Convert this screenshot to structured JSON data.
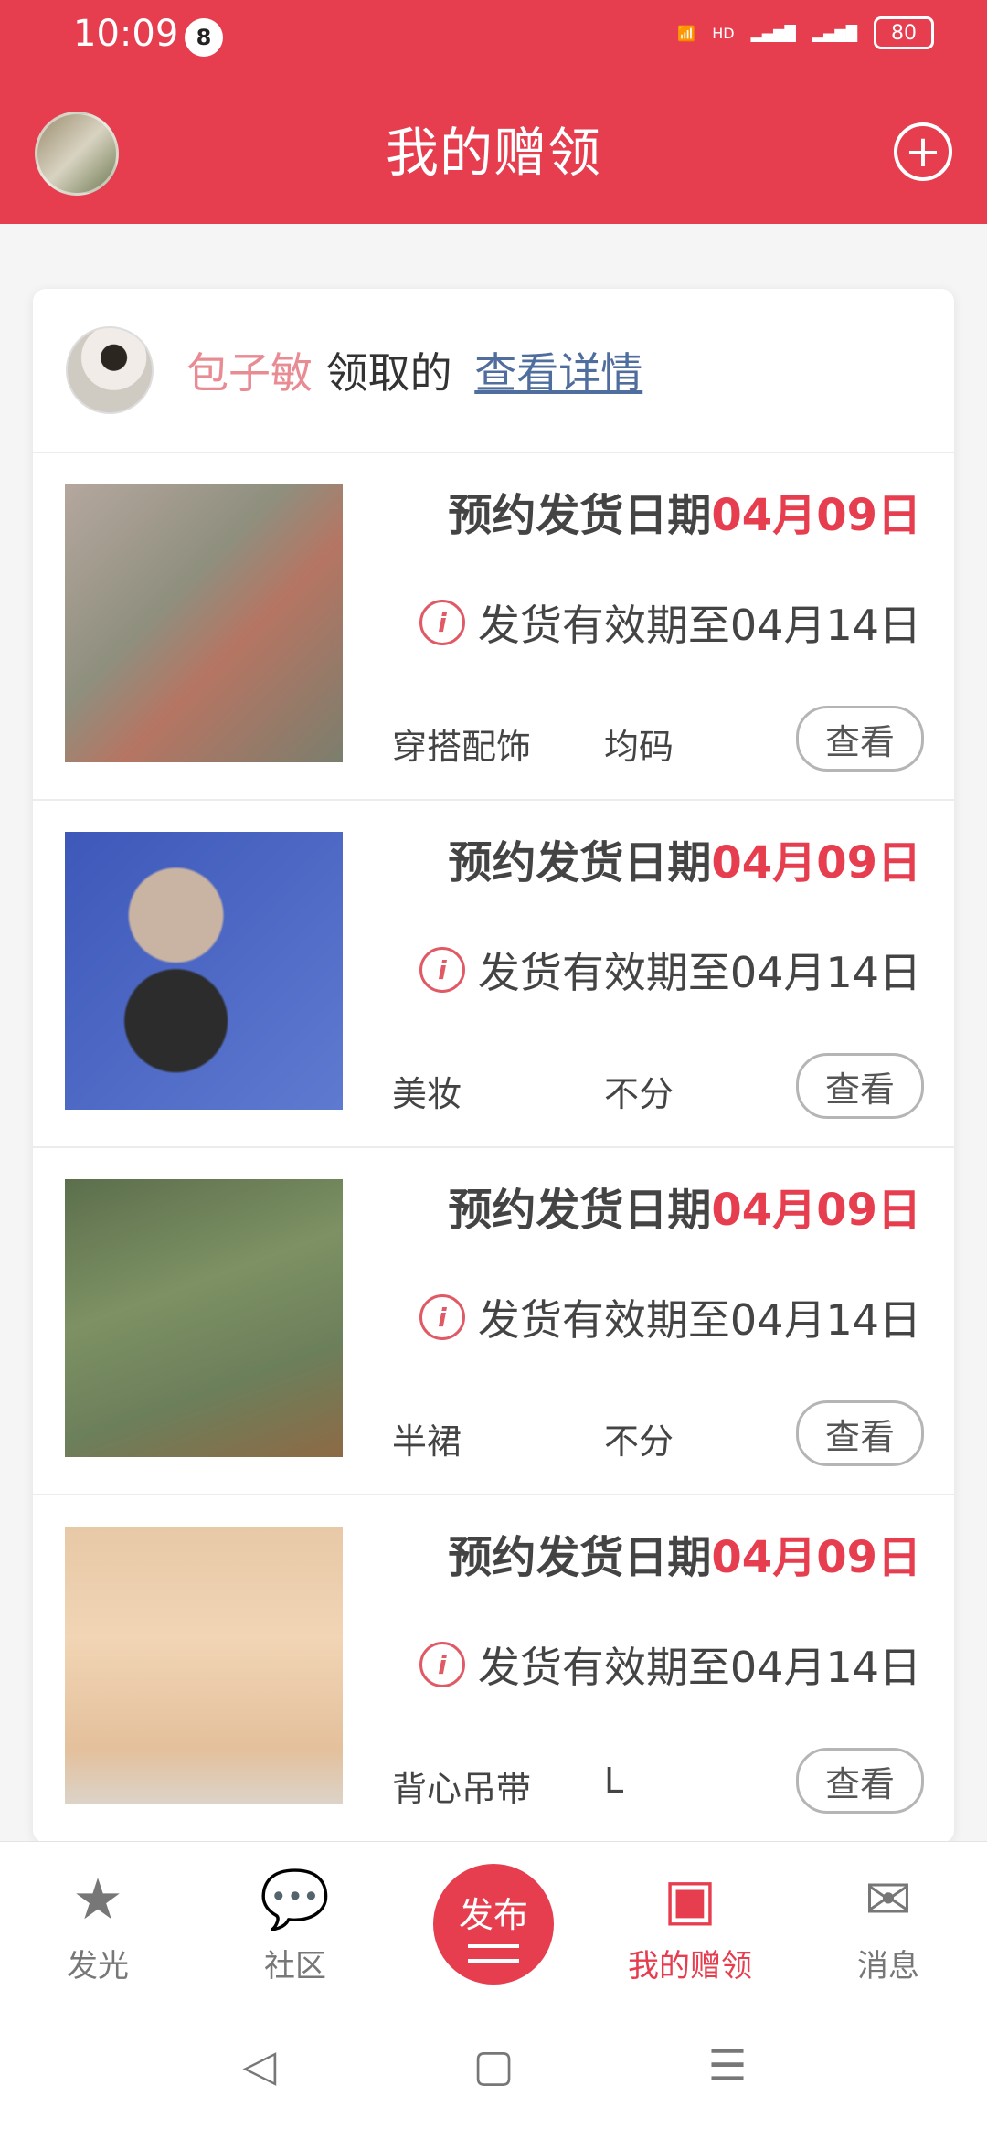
{
  "status_bar": {
    "time": "10:09",
    "notification_count": "8",
    "battery": "80"
  },
  "header": {
    "title": "我的赠领"
  },
  "donor": {
    "name": "包子敏",
    "action": "领取的",
    "link": "查看详情"
  },
  "items": [
    {
      "ship_prefix": "预约发货日期",
      "ship_date": "04月09日",
      "validity": "发货有效期至04月14日",
      "category": "穿搭配饰",
      "size": "均码",
      "button": "查看"
    },
    {
      "ship_prefix": "预约发货日期",
      "ship_date": "04月09日",
      "validity": "发货有效期至04月14日",
      "category": "美妆",
      "size": "不分",
      "button": "查看"
    },
    {
      "ship_prefix": "预约发货日期",
      "ship_date": "04月09日",
      "validity": "发货有效期至04月14日",
      "category": "半裙",
      "size": "不分",
      "button": "查看"
    },
    {
      "ship_prefix": "预约发货日期",
      "ship_date": "04月09日",
      "validity": "发货有效期至04月14日",
      "category": "背心吊带",
      "size": "L",
      "button": "查看"
    }
  ],
  "tabs": [
    {
      "label": "发光",
      "icon": "star-icon"
    },
    {
      "label": "社区",
      "icon": "chat-icon"
    },
    {
      "label": "发布",
      "icon": "publish-icon"
    },
    {
      "label": "我的赠领",
      "icon": "gift-icon"
    },
    {
      "label": "消息",
      "icon": "mail-icon"
    }
  ],
  "colors": {
    "accent": "#e63d4f",
    "donor_name": "#e88b93",
    "link": "#4f6e9e"
  }
}
